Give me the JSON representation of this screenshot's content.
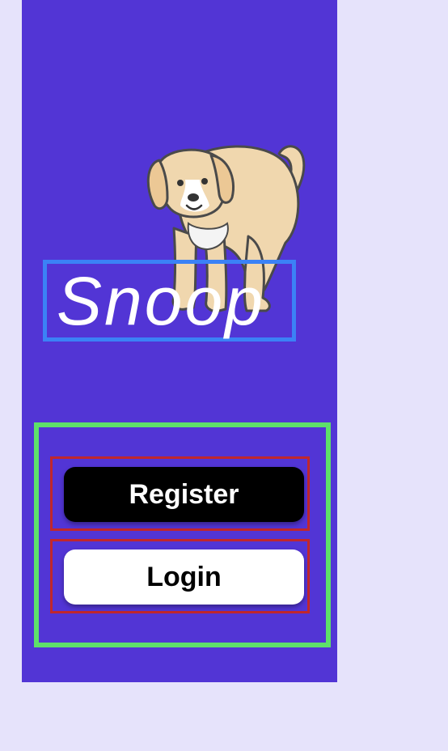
{
  "app": {
    "title": "Snoop",
    "background_color": "#5235d5",
    "page_background": "#e6e3fb"
  },
  "hero": {
    "image_icon": "dog-illustration-icon"
  },
  "actions": {
    "register_label": "Register",
    "login_label": "Login",
    "register_color": "#000000",
    "login_color": "#ffffff"
  }
}
